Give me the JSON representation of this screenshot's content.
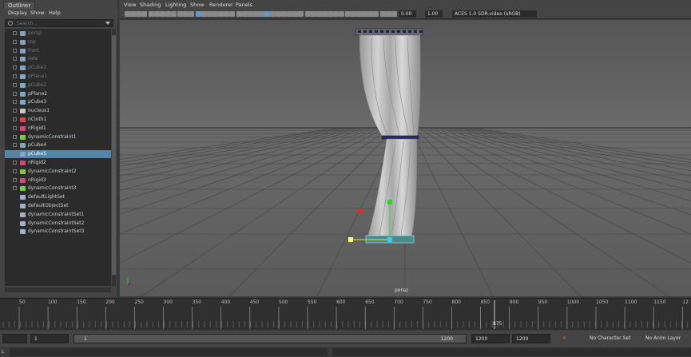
{
  "outliner": {
    "tab": "Outliner",
    "menu": [
      "Display",
      "Show",
      "Help"
    ],
    "search_placeholder": "Search...",
    "items": [
      {
        "label": "persp",
        "dim": true
      },
      {
        "label": "top",
        "dim": true
      },
      {
        "label": "front",
        "dim": true
      },
      {
        "label": "side",
        "dim": true
      },
      {
        "label": "pCube1",
        "dim": true
      },
      {
        "label": "pPlane1",
        "dim": true
      },
      {
        "label": "pCube2",
        "dim": true
      },
      {
        "label": "pPlane2",
        "dim": false
      },
      {
        "label": "pCube3",
        "dim": false
      },
      {
        "label": "nucleus1",
        "dim": false
      },
      {
        "label": "nCloth1",
        "dim": false
      },
      {
        "label": "nRigid1",
        "dim": false
      },
      {
        "label": "dynamicConstraint1",
        "dim": false
      },
      {
        "label": "pCube4",
        "dim": false
      },
      {
        "label": "pCube5",
        "dim": false,
        "selected": true
      },
      {
        "label": "nRigid2",
        "dim": false
      },
      {
        "label": "dynamicConstraint2",
        "dim": false
      },
      {
        "label": "nRigid3",
        "dim": false
      },
      {
        "label": "dynamicConstraint3",
        "dim": false
      },
      {
        "label": "defaultLightSet",
        "dim": false
      },
      {
        "label": "defaultObjectSet",
        "dim": false
      },
      {
        "label": "dynamicConstraintSet1",
        "dim": false
      },
      {
        "label": "dynamicConstraintSet2",
        "dim": false
      },
      {
        "label": "dynamicConstraintSet3",
        "dim": false
      }
    ]
  },
  "viewport": {
    "menu": [
      "View",
      "Shading",
      "Lighting",
      "Show",
      "Renderer",
      "Panels"
    ],
    "exposure": "0.00",
    "gamma": "1.00",
    "colorspace": "ACES 1.0 SDR-video (sRGB)",
    "camera_label": "persp"
  },
  "timeline": {
    "ticks": [
      "50",
      "100",
      "150",
      "200",
      "250",
      "300",
      "350",
      "400",
      "450",
      "500",
      "550",
      "600",
      "650",
      "700",
      "750",
      "800",
      "850",
      "900",
      "950",
      "1000",
      "1050",
      "1100",
      "1150",
      "12"
    ],
    "current_frame": "875"
  },
  "range": {
    "start": "1",
    "inner_start": "1",
    "inner_end": "1200",
    "end": "1200",
    "total_end": "1200",
    "character_set": "No Character Set",
    "anim_layer": "No Anim Layer"
  },
  "command": {
    "lang": "L"
  },
  "colors": {
    "selected": "#5285a6",
    "viewport_bg": "#6b6b6b"
  }
}
